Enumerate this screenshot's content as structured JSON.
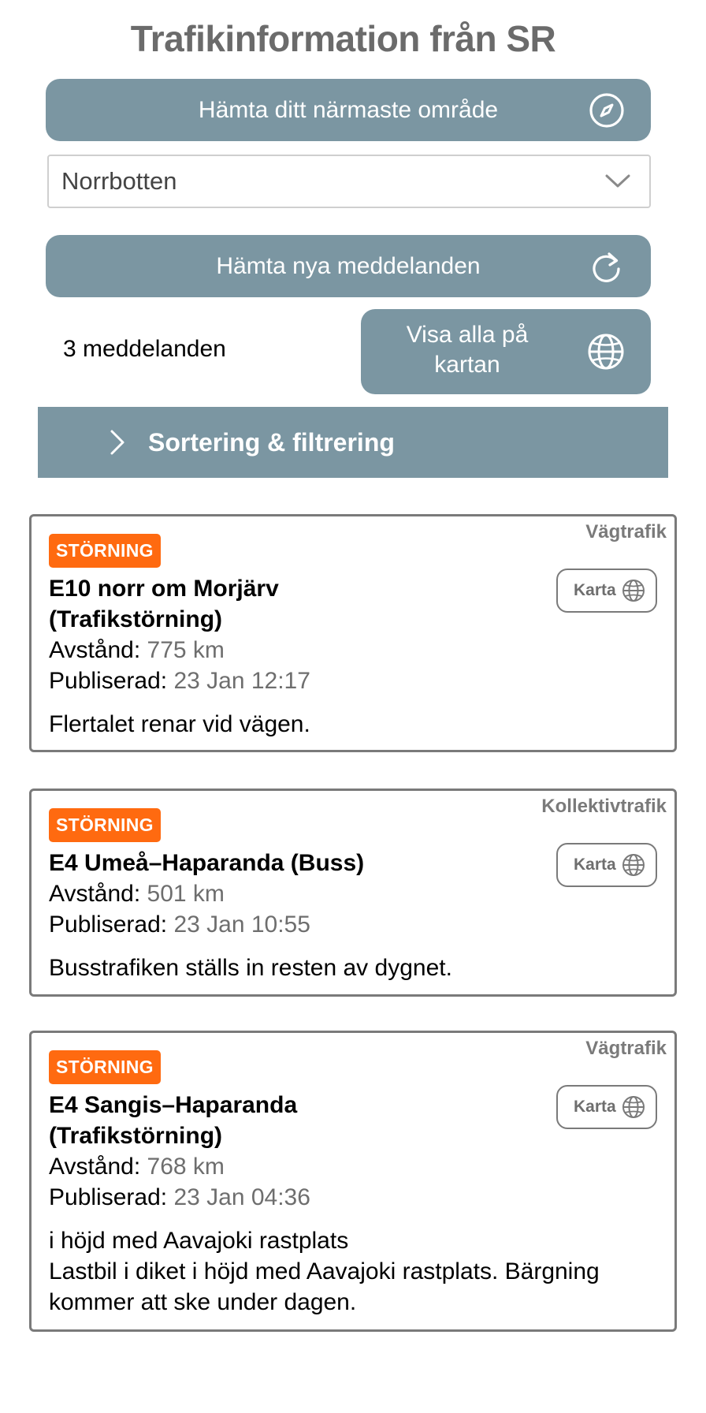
{
  "header": {
    "title": "Trafikinformation från SR"
  },
  "controls": {
    "nearest_area_label": "Hämta ditt närmaste område",
    "region_selected": "Norrbotten",
    "refresh_label": "Hämta nya meddelanden",
    "message_count": "3 meddelanden",
    "map_all_label": "Visa alla på kartan",
    "filter_label": "Sortering & filtrering"
  },
  "colors": {
    "button_bg": "#7b96a2",
    "badge_bg": "#ff6a10",
    "title_gray": "#6b6b6b",
    "border_gray": "#7a7a7a"
  },
  "icons": {
    "nearest_area": "compass-icon",
    "refresh": "refresh-icon",
    "map_all": "globe-icon",
    "select": "chevron-down-icon",
    "filter": "chevron-right-icon",
    "card_map": "globe-icon"
  },
  "messages": [
    {
      "category": "Vägtrafik",
      "badge": "STÖRNING",
      "title": "E10 norr om Morjärv (Trafikstörning)",
      "distance_label": "Avstånd:",
      "distance": "775 km",
      "published_label": "Publiserad:",
      "published": "23 Jan 12:17",
      "description": "Flertalet renar vid vägen.",
      "map_label": "Karta"
    },
    {
      "category": "Kollektivtrafik",
      "badge": "STÖRNING",
      "title": "E4 Umeå–Haparanda (Buss)",
      "distance_label": "Avstånd:",
      "distance": "501 km",
      "published_label": "Publiserad:",
      "published": "23 Jan 10:55",
      "description": "Busstrafiken ställs in resten av dygnet.",
      "map_label": "Karta"
    },
    {
      "category": "Vägtrafik",
      "badge": "STÖRNING",
      "title": "E4 Sangis–Haparanda (Trafikstörning)",
      "distance_label": "Avstånd:",
      "distance": "768 km",
      "published_label": "Publiserad:",
      "published": "23 Jan 04:36",
      "description_line1": "i höjd med Aavajoki rastplats",
      "description": "Lastbil i diket i höjd med Aavajoki rastplats. Bärgning kommer att ske under dagen.",
      "map_label": "Karta"
    }
  ]
}
